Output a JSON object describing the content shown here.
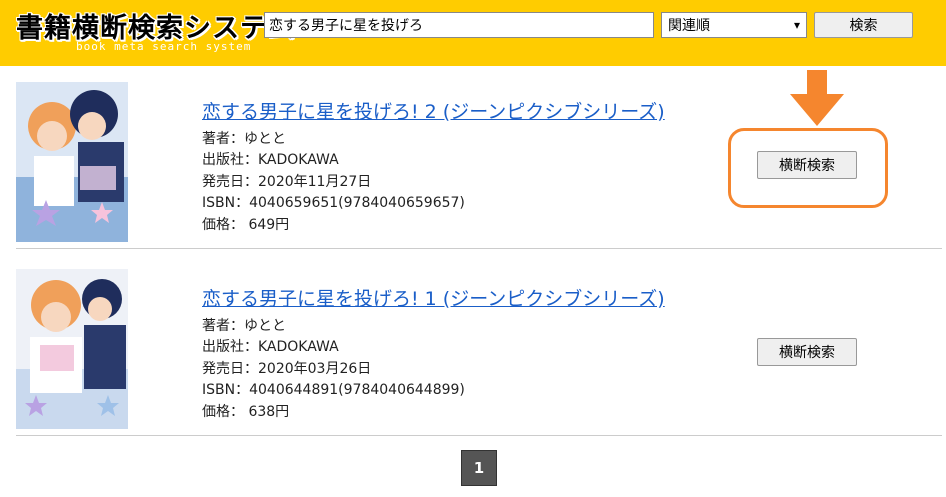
{
  "header": {
    "logo_title": "書籍横断検索システム",
    "logo_subtitle": "book meta search system",
    "search_value": "恋する男子に星を投げろ",
    "sort_selected": "関連順",
    "search_button_label": "検索",
    "background_color": "#ffcc00"
  },
  "results": [
    {
      "title": "恋する男子に星を投げろ! 2 (ジーンピクシブシリーズ)",
      "author": "著者：ゆとと",
      "publisher": "出版社：KADOKAWA",
      "release_date": "発売日：2020年11月27日",
      "isbn": "ISBN：4040659651(9784040659657)",
      "price": "価格： 649円",
      "cross_search_label": "横断検索",
      "cover_icon": "book-cover-image"
    },
    {
      "title": "恋する男子に星を投げろ! 1 (ジーンピクシブシリーズ)",
      "author": "著者：ゆとと",
      "publisher": "出版社：KADOKAWA",
      "release_date": "発売日：2020年03月26日",
      "isbn": "ISBN：4040644891(9784040644899)",
      "price": "価格： 638円",
      "cross_search_label": "横断検索",
      "cover_icon": "book-cover-image"
    }
  ],
  "annotation": {
    "highlight_color": "#f5862e",
    "arrow_icon": "arrow-down-icon"
  },
  "pagination": {
    "current_page": "1"
  }
}
